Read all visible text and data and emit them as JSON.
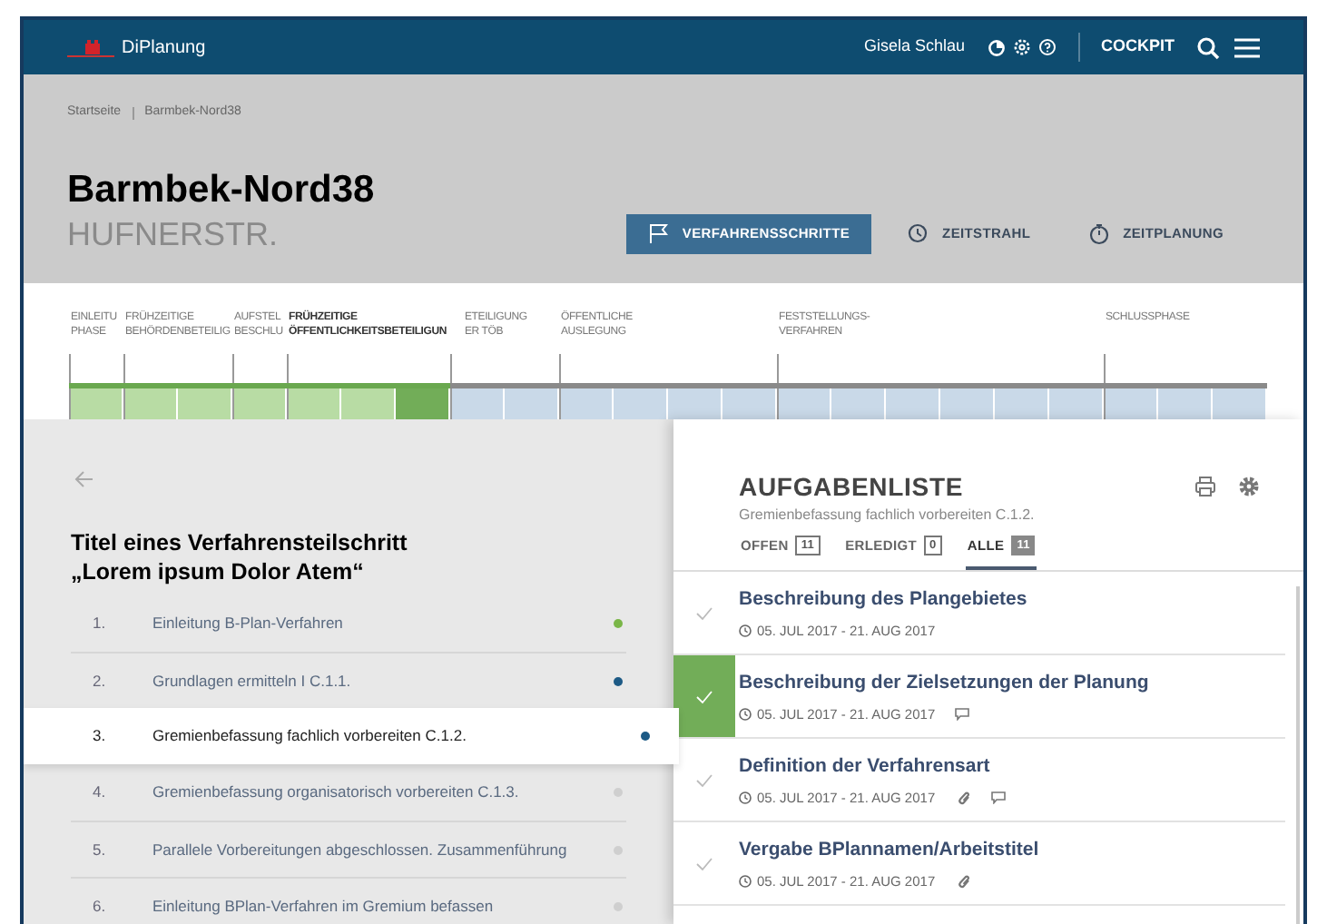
{
  "header": {
    "app_name": "DiPlanung",
    "user": "Gisela Schlau",
    "cockpit": "COCKPIT"
  },
  "breadcrumb": [
    "Startseite",
    "Barmbek-Nord38"
  ],
  "title": "Barmbek-Nord38",
  "subtitle": "HUFNERSTR.",
  "views": [
    {
      "label": "VERFAHRENSSCHRITTE",
      "kind": "flag",
      "selected": true
    },
    {
      "label": "ZEITSTRAHL",
      "kind": "clock",
      "selected": false
    },
    {
      "label": "ZEITPLANUNG",
      "kind": "stopwatch",
      "selected": false
    }
  ],
  "timeline": {
    "phases": [
      {
        "lines": [
          "EINLEITU",
          "PHASE"
        ],
        "selected": false,
        "segments": [
          {
            "done": true,
            "current": false
          }
        ]
      },
      {
        "lines": [
          "FRÜHZEITIGE",
          "BEHÖRDENBETEILIG"
        ],
        "selected": false,
        "segments": [
          {
            "done": true,
            "current": false
          },
          {
            "done": true,
            "current": false
          }
        ]
      },
      {
        "lines": [
          "AUFSTEL",
          "BESCHLU"
        ],
        "selected": false,
        "segments": [
          {
            "done": true,
            "current": false
          }
        ]
      },
      {
        "lines": [
          "FRÜHZEITIGE",
          "ÖFFENTLICHKEITSBETEILIGUN"
        ],
        "selected": true,
        "segments": [
          {
            "done": true,
            "current": false
          },
          {
            "done": true,
            "current": false
          },
          {
            "done": true,
            "current": true
          }
        ]
      },
      {
        "lines": [
          "ETEILIGUNG",
          "ER TÖB"
        ],
        "selected": false,
        "segments": [
          {
            "done": false,
            "current": false
          },
          {
            "done": false,
            "current": false
          }
        ]
      },
      {
        "lines": [
          "ÖFFENTLICHE",
          "AUSLEGUNG"
        ],
        "selected": false,
        "segments": [
          {
            "done": false,
            "current": false
          },
          {
            "done": false,
            "current": false
          },
          {
            "done": false,
            "current": false
          },
          {
            "done": false,
            "current": false
          }
        ]
      },
      {
        "lines": [
          "FESTSTELLUNGS-",
          "VERFAHREN"
        ],
        "selected": false,
        "segments": [
          {
            "done": false,
            "current": false
          },
          {
            "done": false,
            "current": false
          },
          {
            "done": false,
            "current": false
          },
          {
            "done": false,
            "current": false
          },
          {
            "done": false,
            "current": false
          },
          {
            "done": false,
            "current": false
          }
        ]
      },
      {
        "lines": [
          "SCHLUSSPHASE"
        ],
        "selected": false,
        "segments": [
          {
            "done": false,
            "current": false
          },
          {
            "done": false,
            "current": false
          },
          {
            "done": false,
            "current": false
          }
        ]
      }
    ]
  },
  "steps": {
    "title": "Titel eines Verfahrensteilschritt",
    "subtitle": "„Lorem ipsum Dolor Atem“",
    "items": [
      {
        "number": "1.",
        "label": "Einleitung B-Plan-Verfahren",
        "color": "#7ab648",
        "selected": false
      },
      {
        "number": "2.",
        "label": "Grundlagen ermitteln I C.1.1.",
        "color": "#1d5a85",
        "selected": false
      },
      {
        "number": "3.",
        "label": "Gremienbefassung fachlich vorbereiten C.1.2.",
        "color": "#1d5a85",
        "selected": true
      },
      {
        "number": "4.",
        "label": "Gremienbefassung organisatorisch vorbereiten C.1.3.",
        "color": "#cfcfcf",
        "selected": false
      },
      {
        "number": "5.",
        "label": "Parallele Vorbereitungen abgeschlossen. Zusammenführung",
        "color": "#cfcfcf",
        "selected": false
      },
      {
        "number": "6.",
        "label": "Einleitung BPlan-Verfahren im Gremium befassen",
        "color": "#cfcfcf",
        "selected": false
      }
    ]
  },
  "tasks": {
    "title": "AUFGABENLISTE",
    "subtitle": "Gremienbefassung fachlich vorbereiten C.1.2.",
    "tabs": [
      {
        "label": "OFFEN",
        "count": "11",
        "selected": false
      },
      {
        "label": "ERLEDIGT",
        "count": "0",
        "selected": false
      },
      {
        "label": "ALLE",
        "count": "11",
        "selected": true
      }
    ],
    "items": [
      {
        "title": "Beschreibung des Plangebietes",
        "dates": "05. JUL 2017 - 21. AUG 2017",
        "checked": false,
        "attachment": false,
        "comment": false
      },
      {
        "title": "Beschreibung der Zielsetzungen der Planung",
        "dates": "05. JUL 2017 - 21. AUG 2017",
        "checked": true,
        "attachment": false,
        "comment": true
      },
      {
        "title": "Definition der Verfahrensart",
        "dates": "05. JUL 2017 - 21. AUG 2017",
        "checked": false,
        "attachment": true,
        "comment": true
      },
      {
        "title": "Vergabe BPlannamen/Arbeitstitel",
        "dates": "05. JUL 2017 - 21. AUG 2017",
        "checked": false,
        "attachment": true,
        "comment": false
      }
    ]
  }
}
